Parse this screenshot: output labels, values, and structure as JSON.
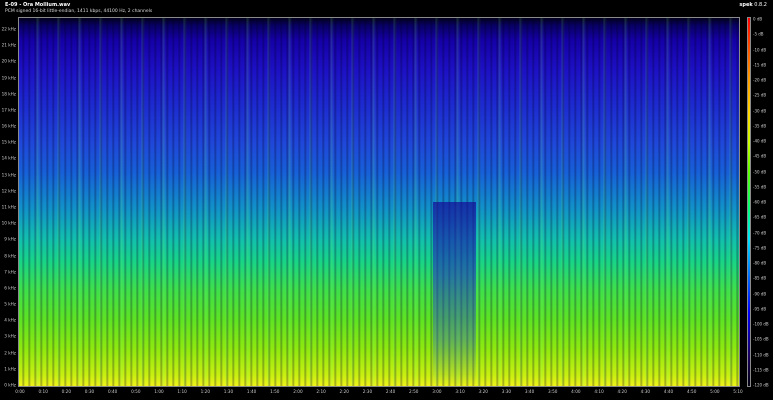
{
  "window": {
    "title": "E-09 - Ora Mollium.wav",
    "subtitle": "PCM signed 16-bit little-endian, 1411 kbps, 44100 Hz, 2 channels",
    "app_name": "spek",
    "app_version": "0.8.2"
  },
  "colors": {
    "background": "#000000",
    "spectrum_low": "#0b0070",
    "spectrum_mid": "#1b9fd0",
    "spectrum_high": "#eef21a"
  },
  "y_axis": {
    "unit": "kHz",
    "ticks": [
      "0 kHz",
      "1 kHz",
      "2 kHz",
      "3 kHz",
      "4 kHz",
      "5 kHz",
      "6 kHz",
      "7 kHz",
      "8 kHz",
      "9 kHz",
      "10 kHz",
      "11 kHz",
      "12 kHz",
      "13 kHz",
      "14 kHz",
      "15 kHz",
      "16 kHz",
      "17 kHz",
      "18 kHz",
      "19 kHz",
      "20 kHz",
      "21 kHz",
      "22 kHz"
    ],
    "range": [
      0,
      22
    ]
  },
  "x_axis": {
    "ticks": [
      "0:00",
      "0:10",
      "0:20",
      "0:30",
      "0:40",
      "0:50",
      "1:00",
      "1:10",
      "1:20",
      "1:30",
      "1:40",
      "1:50",
      "2:00",
      "2:10",
      "2:20",
      "2:30",
      "2:40",
      "2:50",
      "3:00",
      "3:10",
      "3:20",
      "3:30",
      "3:40",
      "3:50",
      "4:00",
      "4:10",
      "4:20",
      "4:30",
      "4:40",
      "4:50",
      "5:00",
      "5:10"
    ]
  },
  "colorbar": {
    "ticks": [
      "0 dB",
      "-5 dB",
      "-10 dB",
      "-15 dB",
      "-20 dB",
      "-25 dB",
      "-30 dB",
      "-35 dB",
      "-40 dB",
      "-45 dB",
      "-50 dB",
      "-55 dB",
      "-60 dB",
      "-65 dB",
      "-70 dB",
      "-75 dB",
      "-80 dB",
      "-85 dB",
      "-90 dB",
      "-95 dB",
      "-100 dB",
      "-105 dB",
      "-110 dB",
      "-115 dB",
      "-120 dB"
    ],
    "range": [
      0,
      -120
    ]
  }
}
